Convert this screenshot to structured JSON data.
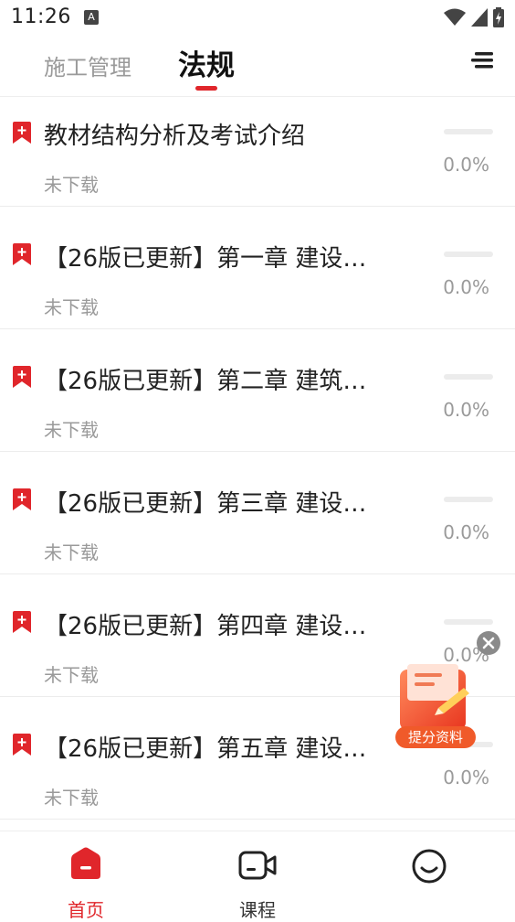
{
  "status_bar": {
    "time": "11:26"
  },
  "tabs": [
    {
      "label": "施工管理",
      "active": false
    },
    {
      "label": "法规",
      "active": true
    }
  ],
  "items": [
    {
      "title": "教材结构分析及考试介绍",
      "status": "未下载",
      "progress": "0.0%"
    },
    {
      "title": "【26版已更新】第一章 建设…",
      "status": "未下载",
      "progress": "0.0%"
    },
    {
      "title": "【26版已更新】第二章 建筑…",
      "status": "未下载",
      "progress": "0.0%"
    },
    {
      "title": "【26版已更新】第三章 建设…",
      "status": "未下载",
      "progress": "0.0%"
    },
    {
      "title": "【26版已更新】第四章 建设…",
      "status": "未下载",
      "progress": "0.0%"
    },
    {
      "title": "【26版已更新】第五章 建设…",
      "status": "未下载",
      "progress": "0.0%"
    }
  ],
  "promo": {
    "label": "提分资料"
  },
  "bottom_nav": [
    {
      "label": "首页",
      "icon": "home-icon",
      "active": true
    },
    {
      "label": "课程",
      "icon": "video-camera-icon",
      "active": false
    },
    {
      "label": "",
      "icon": "smiley-icon",
      "active": false
    }
  ],
  "colors": {
    "accent": "#e0262b",
    "muted": "#9a9a9a",
    "text": "#222222"
  }
}
